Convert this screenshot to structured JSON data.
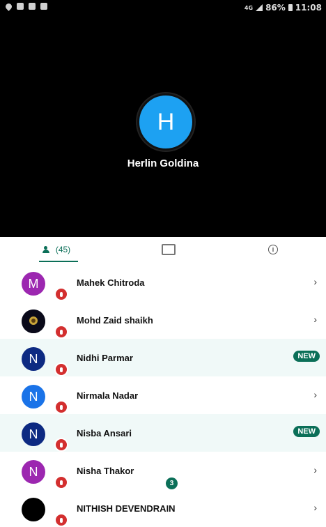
{
  "status_bar": {
    "network": "4G",
    "battery": "86%",
    "time": "11:08"
  },
  "host": {
    "initial": "H",
    "name": "Herlin Goldina",
    "avatar_color": "#1da1f2"
  },
  "tabs": {
    "participants_count": "(45)",
    "chat_badge": "3"
  },
  "participants": [
    {
      "initial": "M",
      "name": "Mahek Chitroda",
      "badge": "",
      "chevron": "›",
      "color": "purple"
    },
    {
      "initial": "",
      "name": "Mohd Zaid shaikh",
      "badge": "",
      "chevron": "›",
      "color": "dark"
    },
    {
      "initial": "N",
      "name": "Nidhi Parmar",
      "badge": "NEW",
      "chevron": "",
      "color": "navy"
    },
    {
      "initial": "N",
      "name": "Nirmala Nadar",
      "badge": "",
      "chevron": "›",
      "color": "blue"
    },
    {
      "initial": "N",
      "name": "Nisba Ansari",
      "badge": "NEW",
      "chevron": "",
      "color": "navy"
    },
    {
      "initial": "N",
      "name": "Nisha Thakor",
      "badge": "",
      "chevron": "›",
      "color": "purple"
    },
    {
      "initial": "",
      "name": "NITHISH DEVENDRAIN",
      "badge": "",
      "chevron": "›",
      "color": "black"
    }
  ],
  "colors": {
    "accent": "#0b6f58",
    "mute_badge": "#d32f2f"
  }
}
